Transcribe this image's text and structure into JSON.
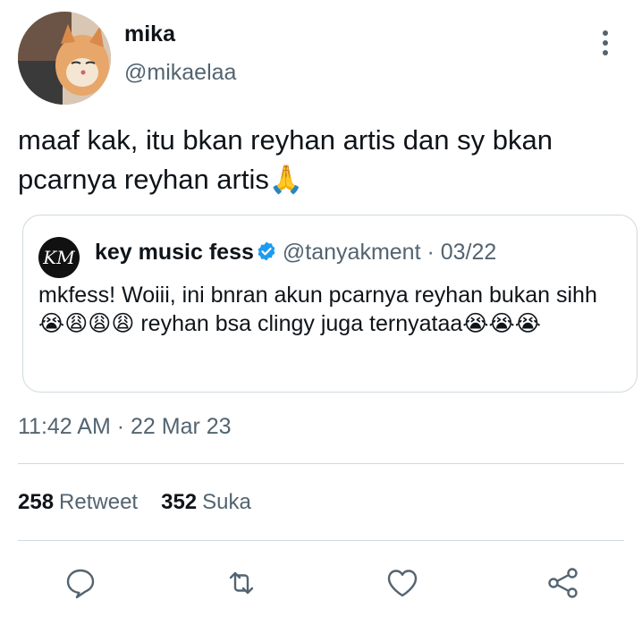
{
  "tweet": {
    "author_name": "mika",
    "author_handle": "@mikaelaa",
    "text": "maaf kak, itu bkan reyhan artis dan sy bkan pcarnya reyhan artis🙏",
    "timestamp": "11:42 AM · 22 Mar 23"
  },
  "quoted_tweet": {
    "avatar_text": "KM",
    "author_name": "key music fess",
    "author_handle": "@tanyakment",
    "date": " · 03/22",
    "text": "mkfess! Woiii, ini bnran akun pcarnya reyhan bukan sihh😭😩😩😩 reyhan bsa clingy juga ternyataa😭😭😭"
  },
  "stats": {
    "retweets_count": "258",
    "retweets_label": "Retweet",
    "likes_count": "352",
    "likes_label": "Suka"
  },
  "icons": {
    "reply": "reply-icon",
    "retweet": "retweet-icon",
    "like": "heart-icon",
    "share": "share-icon",
    "more": "more-vertical-icon",
    "verified": "verified-badge-icon"
  },
  "colors": {
    "text_primary": "#0f1419",
    "text_secondary": "#536471",
    "verified": "#1d9bf0",
    "border": "#cfd9de"
  }
}
